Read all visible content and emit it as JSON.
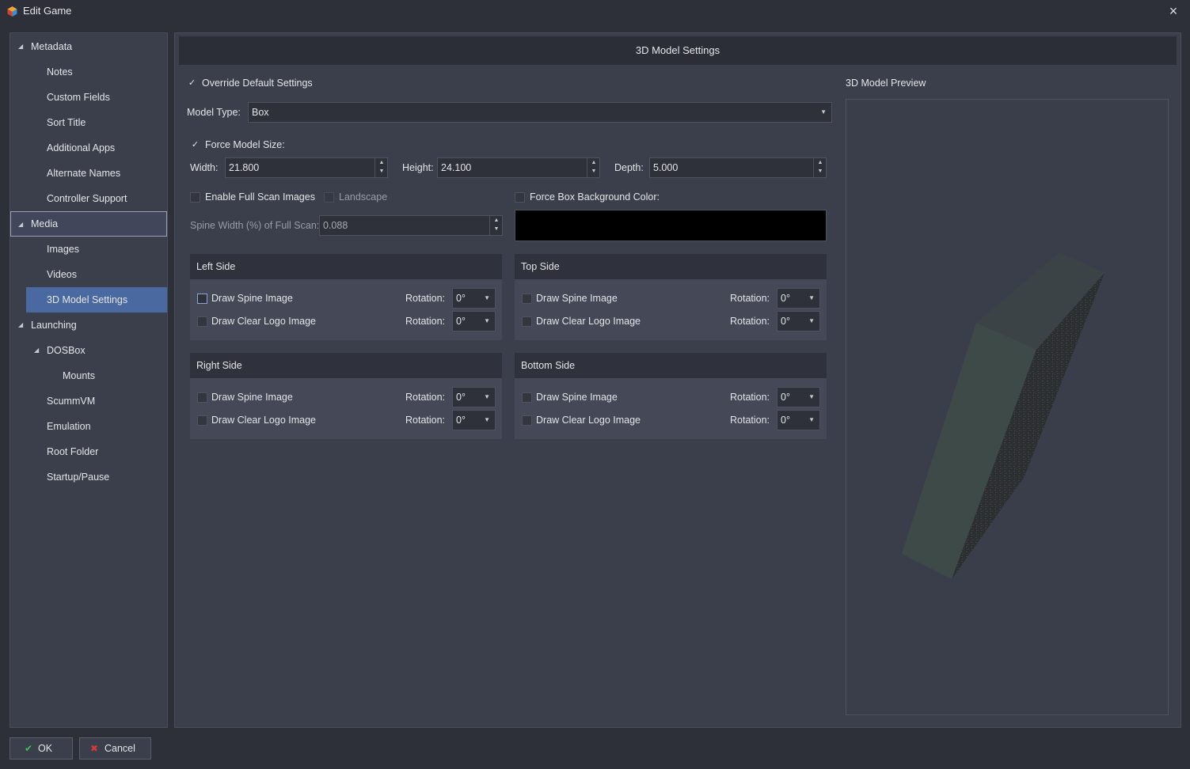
{
  "window": {
    "title": "Edit Game",
    "close_icon": "×"
  },
  "sidebar": {
    "items": [
      {
        "label": "Metadata",
        "arrow": "◢"
      },
      {
        "label": "Notes"
      },
      {
        "label": "Custom Fields"
      },
      {
        "label": "Sort Title"
      },
      {
        "label": "Additional Apps"
      },
      {
        "label": "Alternate Names"
      },
      {
        "label": "Controller Support"
      },
      {
        "label": "Media",
        "arrow": "◢"
      },
      {
        "label": "Images"
      },
      {
        "label": "Videos"
      },
      {
        "label": "3D Model Settings"
      },
      {
        "label": "Launching",
        "arrow": "◢"
      },
      {
        "label": "DOSBox",
        "arrow": "◢"
      },
      {
        "label": "Mounts"
      },
      {
        "label": "ScummVM"
      },
      {
        "label": "Emulation"
      },
      {
        "label": "Root Folder"
      },
      {
        "label": "Startup/Pause"
      }
    ]
  },
  "main": {
    "header": "3D Model Settings",
    "override": {
      "label": "Override Default Settings",
      "checked": true
    },
    "model_type": {
      "label": "Model Type:",
      "value": "Box"
    },
    "force_size": {
      "label": "Force Model Size:",
      "checked": true
    },
    "width": {
      "label": "Width:",
      "value": "21.800"
    },
    "height": {
      "label": "Height:",
      "value": "24.100"
    },
    "depth": {
      "label": "Depth:",
      "value": "5.000"
    },
    "full_scan": {
      "label": "Enable Full Scan Images"
    },
    "landscape": {
      "label": "Landscape"
    },
    "force_bg": {
      "label": "Force Box Background Color:"
    },
    "background_color": "#000000",
    "spine_width": {
      "label": "Spine Width (%) of Full Scan:",
      "value": "0.088"
    },
    "check_mark": "✓",
    "spin_up": "▲",
    "spin_down": "▼",
    "caret": "▼",
    "sides": [
      {
        "title": "Left Side",
        "spine_label": "Draw Spine Image",
        "logo_label": "Draw Clear Logo Image",
        "rotation_label": "Rotation:",
        "spine_rotation": "0°",
        "logo_rotation": "0°"
      },
      {
        "title": "Top Side",
        "spine_label": "Draw Spine Image",
        "logo_label": "Draw Clear Logo Image",
        "rotation_label": "Rotation:",
        "spine_rotation": "0°",
        "logo_rotation": "0°"
      },
      {
        "title": "Right Side",
        "spine_label": "Draw Spine Image",
        "logo_label": "Draw Clear Logo Image",
        "rotation_label": "Rotation:",
        "spine_rotation": "0°",
        "logo_rotation": "0°"
      },
      {
        "title": "Bottom Side",
        "spine_label": "Draw Spine Image",
        "logo_label": "Draw Clear Logo Image",
        "rotation_label": "Rotation:",
        "spine_rotation": "0°",
        "logo_rotation": "0°"
      }
    ],
    "preview_label": "3D Model Preview"
  },
  "footer": {
    "ok_label": "OK",
    "ok_icon": "✔",
    "ok_color": "#3fbf5a",
    "cancel_label": "Cancel",
    "cancel_icon": "✖",
    "cancel_color": "#d33a3a"
  }
}
